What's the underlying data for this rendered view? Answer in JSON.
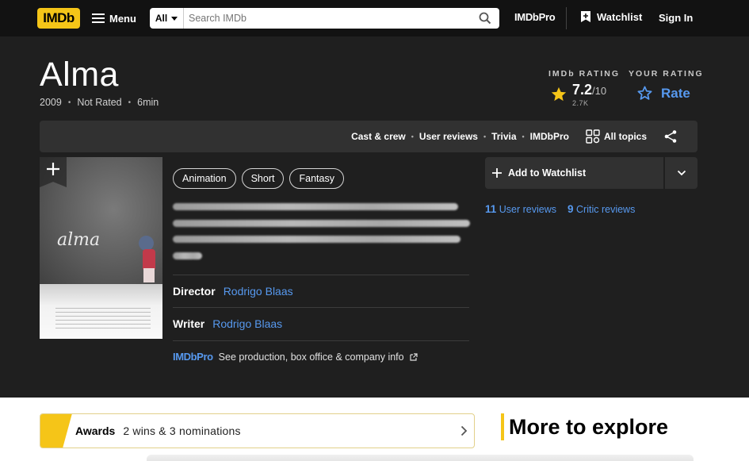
{
  "nav": {
    "logo": "IMDb",
    "menu_label": "Menu",
    "search_category": "All",
    "search_placeholder": "Search IMDb",
    "imdbpro_label": "IMDbPro",
    "watchlist_label": "Watchlist",
    "signin_label": "Sign In"
  },
  "title": {
    "name": "Alma",
    "year": "2009",
    "certificate": "Not Rated",
    "runtime": "6min"
  },
  "rating": {
    "imdb_label": "IMDb RATING",
    "score": "7.2",
    "scale": "/10",
    "votes": "2.7K",
    "your_label": "YOUR RATING",
    "rate_label": "Rate",
    "star_color": "#f5c518",
    "link_color": "#5799ef"
  },
  "subnav": {
    "links": [
      "Cast & crew",
      "User reviews",
      "Trivia",
      "IMDbPro"
    ],
    "all_topics": "All topics"
  },
  "poster": {
    "title_text": "alma"
  },
  "genres": [
    "Animation",
    "Short",
    "Fantasy"
  ],
  "credits": {
    "director_label": "Director",
    "director": "Rodrigo Blaas",
    "writer_label": "Writer",
    "writer": "Rodrigo Blaas",
    "pro_logo": "IMDbPro",
    "pro_text": "See production, box office & company info"
  },
  "actions": {
    "watchlist_button": "Add to Watchlist",
    "user_reviews_count": "11",
    "user_reviews_label": "User reviews",
    "critic_reviews_count": "9",
    "critic_reviews_label": "Critic reviews"
  },
  "awards": {
    "label": "Awards",
    "text": "2 wins & 3 nominations"
  },
  "explore": {
    "heading": "More to explore"
  }
}
